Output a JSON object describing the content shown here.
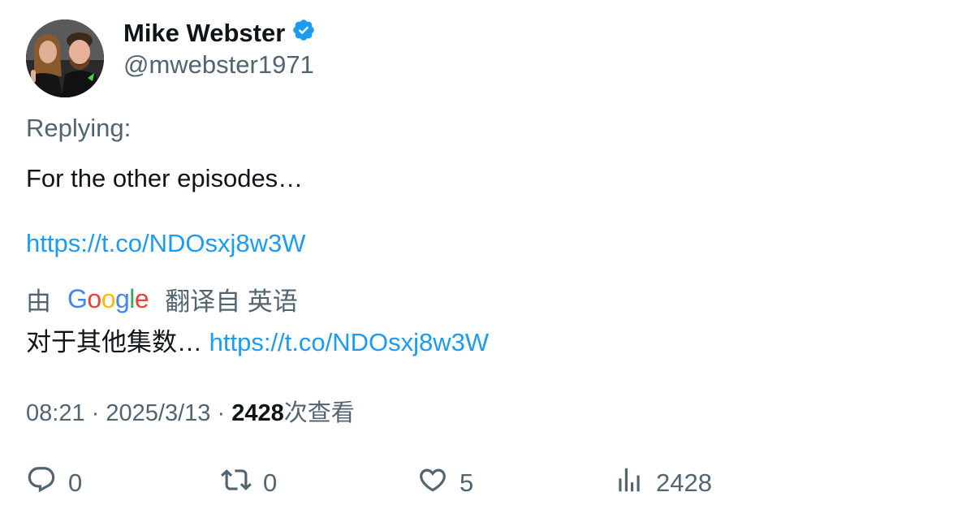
{
  "author": {
    "name": "Mike Webster",
    "verified": true,
    "handle": "@mwebster1971"
  },
  "tweet": {
    "replying_label": "Replying:",
    "text": "For the other episodes…",
    "link": "https://t.co/NDOsxj8w3W"
  },
  "translation": {
    "prefix": "由",
    "provider": "Google",
    "suffix": "翻译自 英语",
    "text": "对于其他集数…",
    "link": "https://t.co/NDOsxj8w3W"
  },
  "meta": {
    "time": "08:21",
    "sep1": "·",
    "date": "2025/3/13",
    "sep2": "·",
    "views": "2428",
    "views_label": "次查看"
  },
  "actions": {
    "replies": "0",
    "retweets": "0",
    "likes": "5",
    "views": "2428"
  },
  "colors": {
    "accent": "#1d9bf0",
    "secondary_text": "#536471",
    "primary_text": "#0f1419"
  }
}
